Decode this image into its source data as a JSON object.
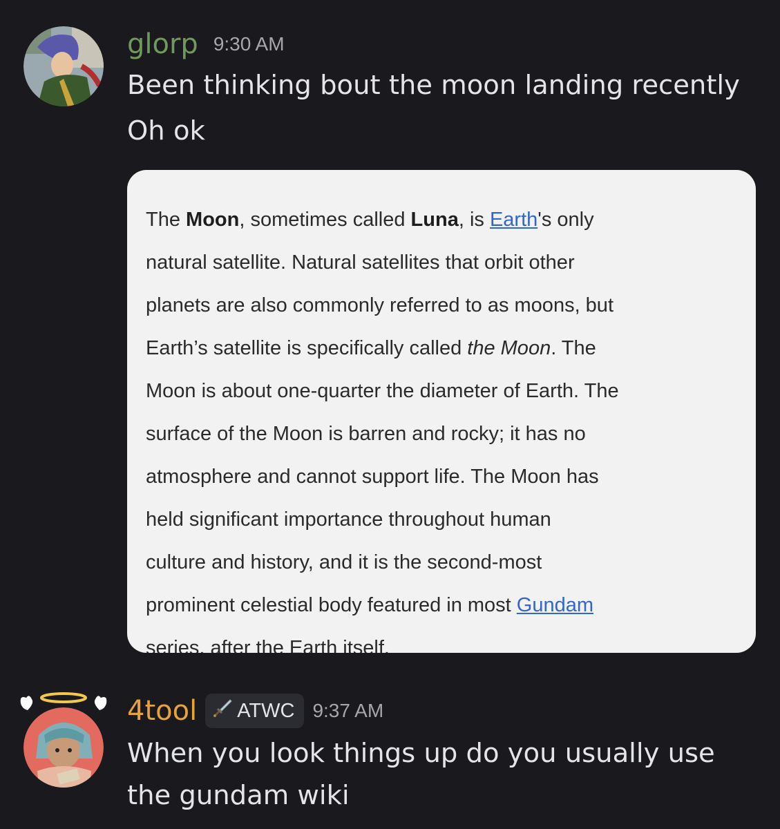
{
  "messages": [
    {
      "username": "glorp",
      "username_color": "#6f9a5b",
      "timestamp": "9:30 AM",
      "lines": [
        "Been thinking bout the moon landing recently",
        "Oh ok"
      ]
    },
    {
      "username": "4tool",
      "username_color": "#e8a23a",
      "tag_icon": "sword-icon",
      "tag_label": "ATWC",
      "timestamp": "9:37 AM",
      "lines": [
        "When you look things up do you usually use",
        "the gundam wiki"
      ]
    }
  ],
  "embed": {
    "l1": {
      "a": "The ",
      "b": "Moon",
      "c": ", sometimes called ",
      "d": "Luna",
      "e": ", is ",
      "link": "Earth",
      "f": "'s only"
    },
    "l2": "natural satellite. Natural satellites that orbit other",
    "l3": "planets are also commonly referred to as moons, but",
    "l4": {
      "a": "Earth’s satellite is specifically called ",
      "i": "the Moon",
      "b": ". The"
    },
    "l5": "Moon is about one-quarter the diameter of Earth. The",
    "l6": "surface of the Moon is barren and rocky; it has no",
    "l7": "atmosphere and cannot support life. The Moon has",
    "l8": "held significant importance throughout human",
    "l9": "culture and history, and it is the second-most",
    "l10": {
      "a": "prominent celestial body featured in most ",
      "link": "Gundam"
    },
    "l11": "series, after the Earth itself."
  }
}
